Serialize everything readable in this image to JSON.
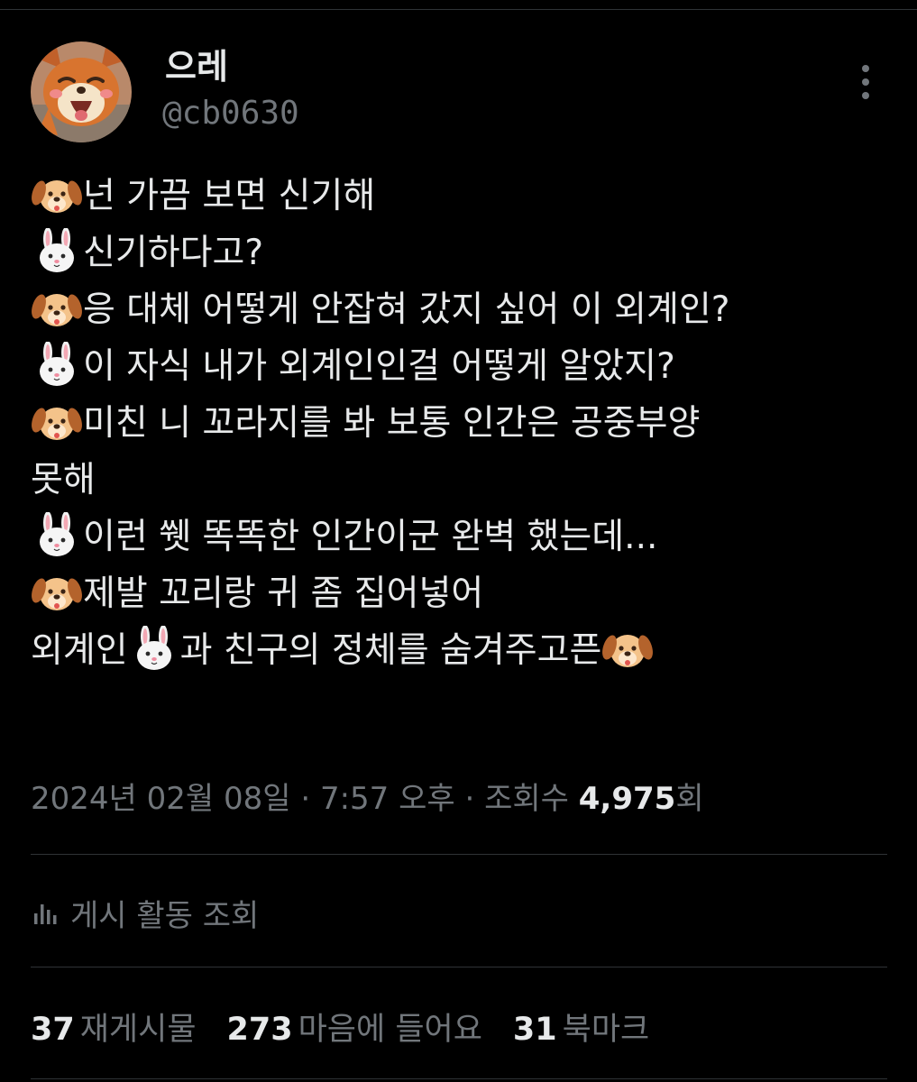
{
  "author": {
    "display_name": "으레",
    "handle": "@cb0630",
    "avatar_icon": "cartoon-fox-avatar"
  },
  "tweet": {
    "lines": [
      {
        "emoji": "dog-face-emoji",
        "text": "넌 가끔 보면 신기해"
      },
      {
        "emoji": "rabbit-face-emoji",
        "text": "신기하다고?"
      },
      {
        "emoji": "dog-face-emoji",
        "text": "응 대체 어떻게 안잡혀 갔지 싶어 이 외계인?"
      },
      {
        "emoji": "rabbit-face-emoji",
        "text": "이 자식 내가 외계인인걸 어떻게 알았지?"
      },
      {
        "emoji": "dog-face-emoji",
        "text": "미친 니 꼬라지를 봐 보통 인간은 공중부양"
      },
      {
        "emoji": "",
        "text": "못해"
      },
      {
        "emoji": "rabbit-face-emoji",
        "text": "이런 쒯 똑똑한 인간이군 완벽 했는데..."
      },
      {
        "emoji": "dog-face-emoji",
        "text": "제발 꼬리랑 귀 좀 집어넣어"
      }
    ],
    "last_line": {
      "part1": "외계인",
      "part2": "과 친구의 정체를 숨겨주고픈"
    }
  },
  "meta": {
    "date": "2024년 02월 08일",
    "separator": " · ",
    "time": "7:57 오후",
    "views_label": "조회수",
    "views_count": "4,975",
    "views_suffix": "회"
  },
  "activity": {
    "label": "게시 활동 조회",
    "icon": "bar-chart-icon"
  },
  "stats": [
    {
      "count": "37",
      "label": "재게시물"
    },
    {
      "count": "273",
      "label": "마음에 들어요"
    },
    {
      "count": "31",
      "label": "북마크"
    }
  ],
  "colors": {
    "background": "#000000",
    "primary_text": "#e7e9ea",
    "secondary_text": "#71767b",
    "divider": "#2f3336"
  }
}
